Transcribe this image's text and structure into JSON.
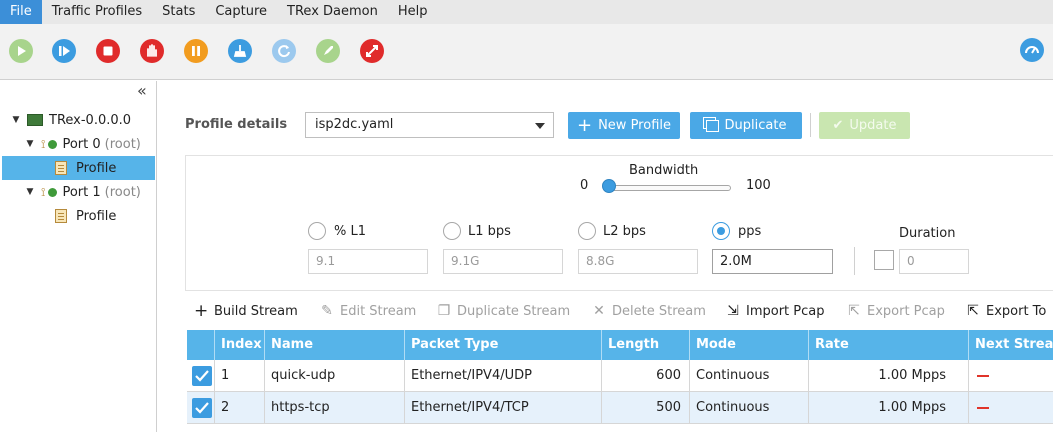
{
  "menu": [
    "File",
    "Traffic Profiles",
    "Stats",
    "Capture",
    "TRex Daemon",
    "Help"
  ],
  "toolbar": {
    "buttons": [
      {
        "name": "start-icon",
        "color": "#a8d48c"
      },
      {
        "name": "step-icon",
        "color": "#3c9ce0"
      },
      {
        "name": "stop-icon",
        "color": "#e02b2b"
      },
      {
        "name": "force-stop-icon",
        "color": "#e02b2b"
      },
      {
        "name": "pause-icon",
        "color": "#f29c1f"
      },
      {
        "name": "clear-icon",
        "color": "#3c9ce0"
      },
      {
        "name": "reconnect-icon",
        "color": "#9cc9ee"
      },
      {
        "name": "launch-icon",
        "color": "#a8d48c"
      },
      {
        "name": "disconnect-icon",
        "color": "#e02b2b"
      },
      {
        "name": "dashboard-icon",
        "color": "#3c9ce0"
      }
    ]
  },
  "tree": {
    "root": "TRex-0.0.0.0",
    "port0": {
      "name": "Port 0",
      "suffix": "(root)",
      "child": "Profile"
    },
    "port1": {
      "name": "Port 1",
      "suffix": "(root)",
      "child": "Profile"
    }
  },
  "profile": {
    "label": "Profile details",
    "selected": "isp2dc.yaml",
    "new_label": "New Profile",
    "duplicate_label": "Duplicate",
    "update_label": "Update"
  },
  "bandwidth": {
    "label": "Bandwidth",
    "min": "0",
    "max": "100",
    "value": 0.05
  },
  "rates": [
    {
      "label": "% L1",
      "value": "9.1",
      "selected": false
    },
    {
      "label": "L1 bps",
      "value": "9.1G",
      "selected": false
    },
    {
      "label": "L2 bps",
      "value": "8.8G",
      "selected": false
    },
    {
      "label": "pps",
      "value": "2.0M",
      "selected": true
    }
  ],
  "duration": {
    "label": "Duration",
    "value": "0"
  },
  "actions": {
    "build": "Build Stream",
    "edit": "Edit Stream",
    "duplicate": "Duplicate Stream",
    "delete": "Delete Stream",
    "import": "Import Pcap",
    "export": "Export Pcap",
    "export_to": "Export To"
  },
  "table": {
    "headers": [
      "Index",
      "Name",
      "Packet Type",
      "Length",
      "Mode",
      "Rate",
      "Next Strea"
    ],
    "rows": [
      {
        "index": "1",
        "name": "quick-udp",
        "type": "Ethernet/IPV4/UDP",
        "length": "600",
        "mode": "Continuous",
        "rate": "1.00 Mpps"
      },
      {
        "index": "2",
        "name": "https-tcp",
        "type": "Ethernet/IPV4/TCP",
        "length": "500",
        "mode": "Continuous",
        "rate": "1.00 Mpps"
      }
    ]
  }
}
